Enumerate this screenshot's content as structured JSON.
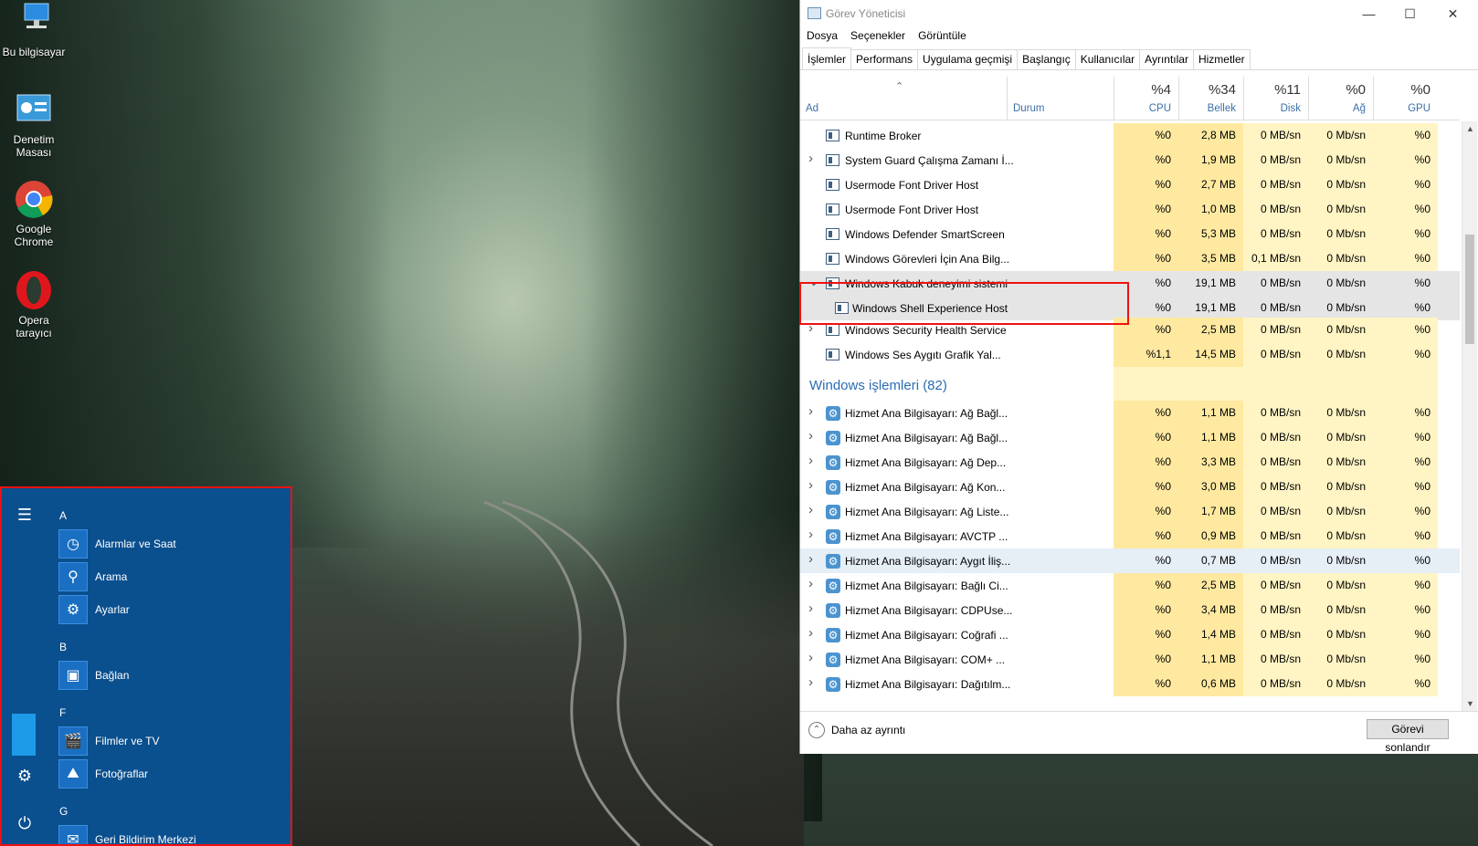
{
  "desktop": {
    "icons": [
      {
        "label": "Bu bilgisayar",
        "icon": "computer-icon"
      },
      {
        "label": "Denetim Masası",
        "icon": "control-panel-icon"
      },
      {
        "label": "Google Chrome",
        "icon": "chrome-icon"
      },
      {
        "label": "Opera tarayıcı",
        "icon": "opera-icon"
      }
    ]
  },
  "start_menu": {
    "sections": [
      {
        "letter": "A",
        "apps": [
          "Alarmlar ve Saat",
          "Arama",
          "Ayarlar"
        ]
      },
      {
        "letter": "B",
        "apps": [
          "Bağlan"
        ]
      },
      {
        "letter": "F",
        "apps": [
          "Filmler ve TV",
          "Fotoğraflar"
        ]
      },
      {
        "letter": "G",
        "apps": [
          "Geri Bildirim Merkezi"
        ]
      }
    ],
    "app_icons": [
      "alarm-clock-icon",
      "search-icon",
      "gear-icon",
      "connect-icon",
      "film-icon",
      "photos-icon",
      "feedback-icon"
    ],
    "rail_icons": [
      "hamburger-menu-icon",
      "settings-icon",
      "power-icon"
    ]
  },
  "task_manager": {
    "title": "Görev Yöneticisi",
    "menu": [
      "Dosya",
      "Seçenekler",
      "Görüntüle"
    ],
    "tabs": [
      "İşlemler",
      "Performans",
      "Uygulama geçmişi",
      "Başlangıç",
      "Kullanıcılar",
      "Ayrıntılar",
      "Hizmetler"
    ],
    "active_tab": "İşlemler",
    "columns": {
      "name": "Ad",
      "status": "Durum",
      "cpu": {
        "pct": "%4",
        "label": "CPU"
      },
      "memory": {
        "pct": "%34",
        "label": "Bellek"
      },
      "disk": {
        "pct": "%11",
        "label": "Disk"
      },
      "network": {
        "pct": "%0",
        "label": "Ağ"
      },
      "gpu": {
        "pct": "%0",
        "label": "GPU"
      }
    },
    "rows": [
      {
        "name": "Runtime Broker",
        "expand": false,
        "cpu": "%0",
        "mem": "2,8 MB",
        "disk": "0 MB/sn",
        "net": "0 Mb/sn",
        "gpu": "%0"
      },
      {
        "name": "System Guard Çalışma Zamanı İ...",
        "expand": true,
        "cpu": "%0",
        "mem": "1,9 MB",
        "disk": "0 MB/sn",
        "net": "0 Mb/sn",
        "gpu": "%0"
      },
      {
        "name": "Usermode Font Driver Host",
        "expand": false,
        "cpu": "%0",
        "mem": "2,7 MB",
        "disk": "0 MB/sn",
        "net": "0 Mb/sn",
        "gpu": "%0"
      },
      {
        "name": "Usermode Font Driver Host",
        "expand": false,
        "cpu": "%0",
        "mem": "1,0 MB",
        "disk": "0 MB/sn",
        "net": "0 Mb/sn",
        "gpu": "%0"
      },
      {
        "name": "Windows Defender SmartScreen",
        "expand": false,
        "cpu": "%0",
        "mem": "5,3 MB",
        "disk": "0 MB/sn",
        "net": "0 Mb/sn",
        "gpu": "%0"
      },
      {
        "name": "Windows Görevleri İçin Ana Bilg...",
        "expand": false,
        "cpu": "%0",
        "mem": "3,5 MB",
        "disk": "0,1 MB/sn",
        "net": "0 Mb/sn",
        "gpu": "%0"
      },
      {
        "name": "Windows Kabuk deneyimi sistemi",
        "expand": "open",
        "cpu": "%0",
        "mem": "19,1 MB",
        "disk": "0 MB/sn",
        "net": "0 Mb/sn",
        "gpu": "%0"
      },
      {
        "name": "Windows Shell Experience Host",
        "child": true,
        "cpu": "%0",
        "mem": "19,1 MB",
        "disk": "0 MB/sn",
        "net": "0 Mb/sn",
        "gpu": "%0"
      },
      {
        "name": "Windows Security Health Service",
        "expand": true,
        "cpu": "%0",
        "mem": "2,5 MB",
        "disk": "0 MB/sn",
        "net": "0 Mb/sn",
        "gpu": "%0"
      },
      {
        "name": "Windows Ses Aygıtı Grafik Yal...",
        "expand": false,
        "cpu": "%1,1",
        "mem": "14,5 MB",
        "disk": "0 MB/sn",
        "net": "0 Mb/sn",
        "gpu": "%0"
      }
    ],
    "group": "Windows işlemleri (82)",
    "service_rows": [
      {
        "name": "Hizmet Ana Bilgisayarı: Ağ Bağl...",
        "cpu": "%0",
        "mem": "1,1 MB",
        "disk": "0 MB/sn",
        "net": "0 Mb/sn",
        "gpu": "%0"
      },
      {
        "name": "Hizmet Ana Bilgisayarı: Ağ Bağl...",
        "cpu": "%0",
        "mem": "1,1 MB",
        "disk": "0 MB/sn",
        "net": "0 Mb/sn",
        "gpu": "%0"
      },
      {
        "name": "Hizmet Ana Bilgisayarı: Ağ Dep...",
        "cpu": "%0",
        "mem": "3,3 MB",
        "disk": "0 MB/sn",
        "net": "0 Mb/sn",
        "gpu": "%0"
      },
      {
        "name": "Hizmet Ana Bilgisayarı: Ağ Kon...",
        "cpu": "%0",
        "mem": "3,0 MB",
        "disk": "0 MB/sn",
        "net": "0 Mb/sn",
        "gpu": "%0"
      },
      {
        "name": "Hizmet Ana Bilgisayarı: Ağ Liste...",
        "cpu": "%0",
        "mem": "1,7 MB",
        "disk": "0 MB/sn",
        "net": "0 Mb/sn",
        "gpu": "%0"
      },
      {
        "name": "Hizmet Ana Bilgisayarı: AVCTP ...",
        "cpu": "%0",
        "mem": "0,9 MB",
        "disk": "0 MB/sn",
        "net": "0 Mb/sn",
        "gpu": "%0"
      },
      {
        "name": "Hizmet Ana Bilgisayarı: Aygıt İliş...",
        "cpu": "%0",
        "mem": "0,7 MB",
        "disk": "0 MB/sn",
        "net": "0 Mb/sn",
        "gpu": "%0"
      },
      {
        "name": "Hizmet Ana Bilgisayarı: Bağlı Ci...",
        "cpu": "%0",
        "mem": "2,5 MB",
        "disk": "0 MB/sn",
        "net": "0 Mb/sn",
        "gpu": "%0"
      },
      {
        "name": "Hizmet Ana Bilgisayarı: CDPUse...",
        "cpu": "%0",
        "mem": "3,4 MB",
        "disk": "0 MB/sn",
        "net": "0 Mb/sn",
        "gpu": "%0"
      },
      {
        "name": "Hizmet Ana Bilgisayarı: Coğrafi ...",
        "cpu": "%0",
        "mem": "1,4 MB",
        "disk": "0 MB/sn",
        "net": "0 Mb/sn",
        "gpu": "%0"
      },
      {
        "name": "Hizmet Ana Bilgisayarı: COM+ ...",
        "cpu": "%0",
        "mem": "1,1 MB",
        "disk": "0 MB/sn",
        "net": "0 Mb/sn",
        "gpu": "%0"
      },
      {
        "name": "Hizmet Ana Bilgisayarı: Dağıtılm...",
        "cpu": "%0",
        "mem": "0,6 MB",
        "disk": "0 MB/sn",
        "net": "0 Mb/sn",
        "gpu": "%0"
      }
    ],
    "footer": {
      "fewer_details": "Daha az ayrıntı",
      "end_task": "Görevi sonlandır"
    }
  },
  "colors": {
    "start_bg": "#0a4f8e",
    "accent": "#1e9be8",
    "highlight_border": "#ee1111",
    "cell_yellow": "#fff4c3",
    "cell_yellow_dark": "#ffe9a0",
    "group_blue": "#2a6db3"
  }
}
